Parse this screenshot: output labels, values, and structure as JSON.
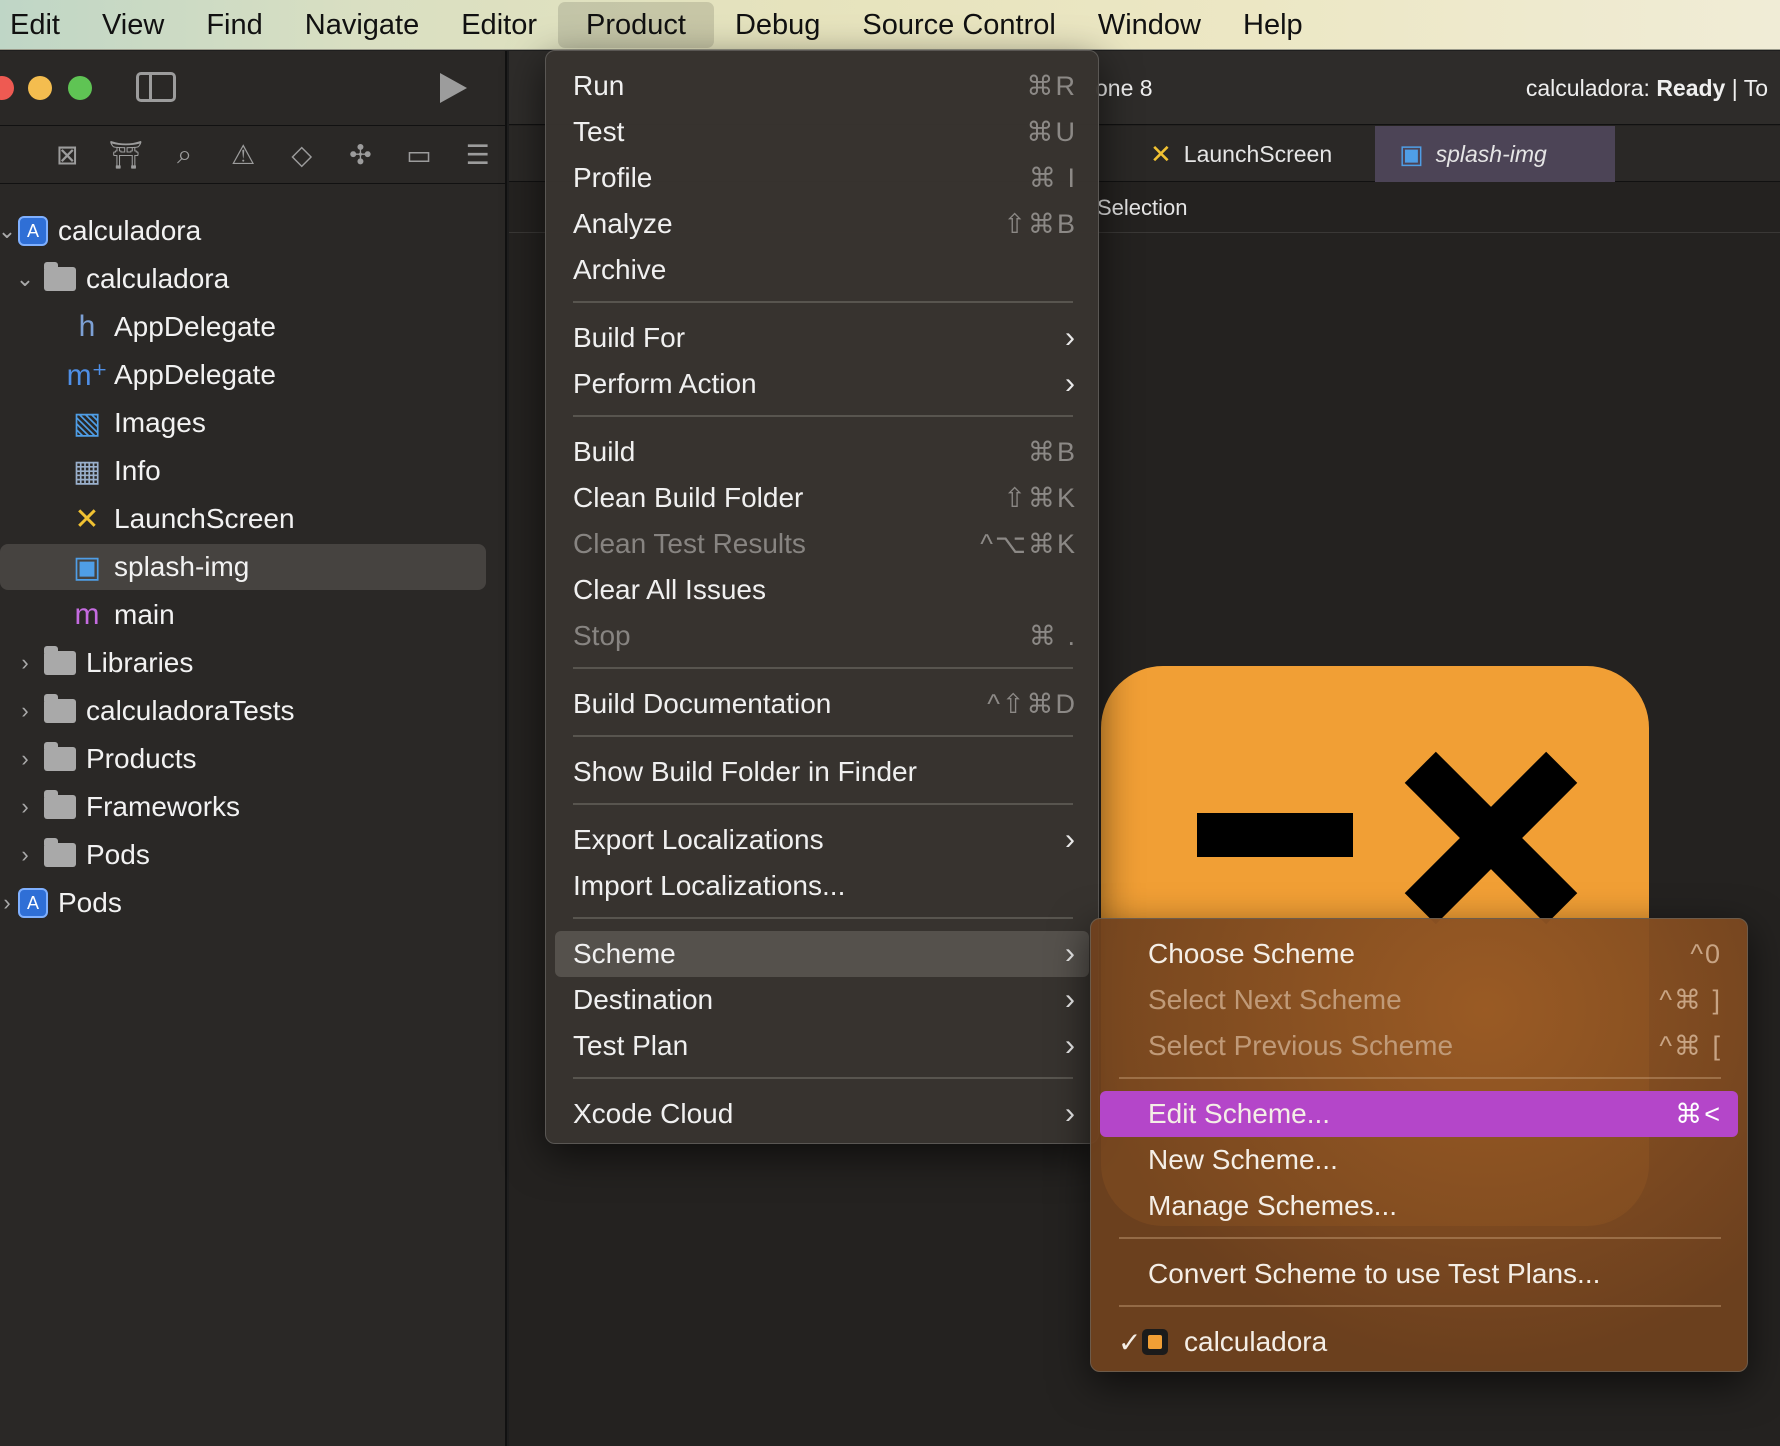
{
  "menubar": {
    "items": [
      "Edit",
      "View",
      "Find",
      "Navigate",
      "Editor",
      "Product",
      "Debug",
      "Source Control",
      "Window",
      "Help"
    ],
    "active": "Product"
  },
  "colors": {
    "accent": "#b446c9",
    "app_icon": "#f19f35"
  },
  "toolbar": {
    "destination_fragment": "one 8",
    "status_app": "calculadora:",
    "status_state": "Ready",
    "status_suffix": "| To"
  },
  "tabs": [
    {
      "label": "LaunchScreen",
      "icon": "storyboard-icon"
    },
    {
      "label": "splash-img",
      "icon": "image-icon",
      "active": true
    }
  ],
  "jumpbar": {
    "label": "Selection"
  },
  "navigator": {
    "tabs": [
      "folder-icon",
      "source-control-icon",
      "hierarchy-icon",
      "search-icon",
      "warning-icon",
      "test-icon",
      "debug-icon",
      "breakpoint-icon",
      "report-icon"
    ],
    "items": [
      {
        "label": "calculadora",
        "icon": "project-icon",
        "level": 0
      },
      {
        "label": "calculadora",
        "icon": "folder-icon",
        "level": 1
      },
      {
        "label": "AppDelegate",
        "icon": "header-file-icon",
        "glyph": "h",
        "level": 2
      },
      {
        "label": "AppDelegate",
        "icon": "objc-file-icon",
        "glyph": "m⁺",
        "level": 2
      },
      {
        "label": "Images",
        "icon": "asset-catalog-icon",
        "level": 2
      },
      {
        "label": "Info",
        "icon": "plist-icon",
        "level": 2
      },
      {
        "label": "LaunchScreen",
        "icon": "storyboard-icon",
        "level": 2
      },
      {
        "label": "splash-img",
        "icon": "image-icon",
        "level": 2,
        "selected": true
      },
      {
        "label": "main",
        "icon": "objc-file-icon",
        "glyph": "m",
        "level": 2
      },
      {
        "label": "Libraries",
        "icon": "folder-icon",
        "level": 1
      },
      {
        "label": "calculadoraTests",
        "icon": "folder-icon",
        "level": 1
      },
      {
        "label": "Products",
        "icon": "folder-icon",
        "level": 1
      },
      {
        "label": "Frameworks",
        "icon": "folder-icon",
        "level": 1
      },
      {
        "label": "Pods",
        "icon": "folder-icon",
        "level": 1
      },
      {
        "label": "Pods",
        "icon": "project-icon",
        "level": 0
      }
    ]
  },
  "product_menu": {
    "items": [
      {
        "label": "Run",
        "shortcut": "⌘R"
      },
      {
        "label": "Test",
        "shortcut": "⌘U"
      },
      {
        "label": "Profile",
        "shortcut": "⌘ I"
      },
      {
        "label": "Analyze",
        "shortcut": "⇧⌘B"
      },
      {
        "label": "Archive",
        "shortcut": ""
      },
      {
        "label": "Build For",
        "submenu": true
      },
      {
        "label": "Perform Action",
        "submenu": true
      },
      {
        "label": "Build",
        "shortcut": "⌘B"
      },
      {
        "label": "Clean Build Folder",
        "shortcut": "⇧⌘K"
      },
      {
        "label": "Clean Test Results",
        "shortcut": "^⌥⌘K",
        "disabled": true
      },
      {
        "label": "Clear All Issues",
        "shortcut": ""
      },
      {
        "label": "Stop",
        "shortcut": "⌘ .",
        "disabled": true
      },
      {
        "label": "Build Documentation",
        "shortcut": "^⇧⌘D"
      },
      {
        "label": "Show Build Folder in Finder",
        "shortcut": ""
      },
      {
        "label": "Export Localizations",
        "submenu": true
      },
      {
        "label": "Import Localizations...",
        "shortcut": ""
      },
      {
        "label": "Scheme",
        "submenu": true,
        "highlighted": true
      },
      {
        "label": "Destination",
        "submenu": true
      },
      {
        "label": "Test Plan",
        "submenu": true
      },
      {
        "label": "Xcode Cloud",
        "submenu": true
      }
    ]
  },
  "scheme_submenu": {
    "items": [
      {
        "label": "Choose Scheme",
        "shortcut": "^0"
      },
      {
        "label": "Select Next Scheme",
        "shortcut": "^⌘ ]",
        "disabled": true
      },
      {
        "label": "Select Previous Scheme",
        "shortcut": "^⌘ [",
        "disabled": true
      },
      {
        "label": "Edit Scheme...",
        "shortcut": "⌘<",
        "highlighted": true
      },
      {
        "label": "New Scheme...",
        "shortcut": ""
      },
      {
        "label": "Manage Schemes...",
        "shortcut": ""
      },
      {
        "label": "Convert Scheme to use Test Plans...",
        "shortcut": ""
      },
      {
        "label": "calculadora",
        "checked": true,
        "check_glyph": "✓"
      }
    ]
  }
}
